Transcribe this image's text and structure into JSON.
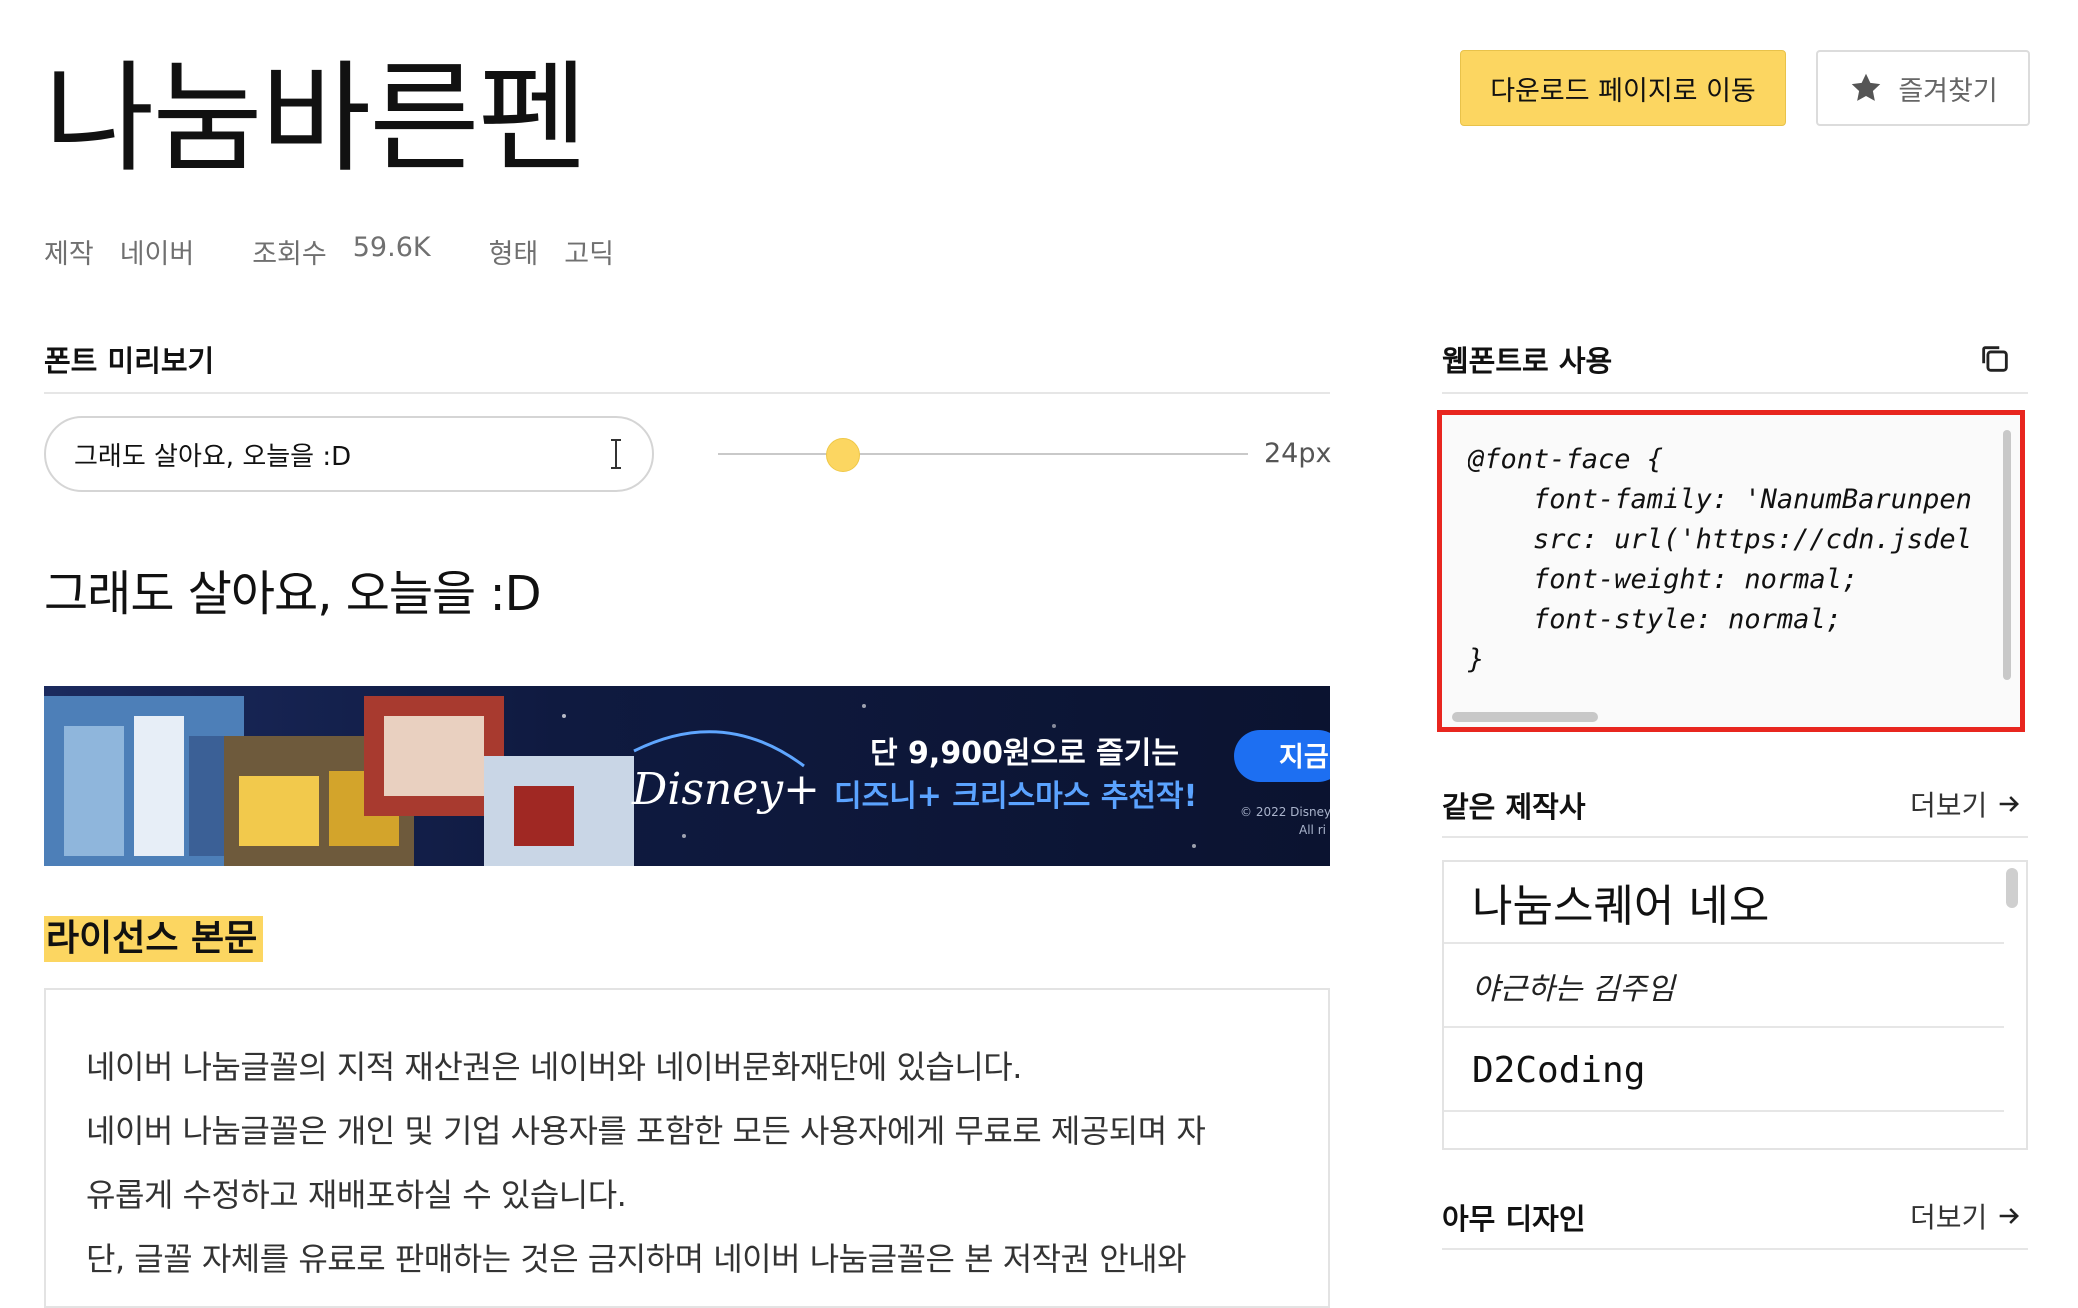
{
  "header": {
    "font_name": "나눔바른펜",
    "meta": [
      {
        "label": "제작",
        "value": "네이버"
      },
      {
        "label": "조회수",
        "value": "59.6K"
      },
      {
        "label": "형태",
        "value": "고딕"
      }
    ],
    "download_label": "다운로드 페이지로 이동",
    "favorite_label": "즐겨찾기"
  },
  "preview": {
    "section_title": "폰트 미리보기",
    "input_value": "그래도 살아요, 오늘을 :D",
    "size_value": 24,
    "size_label": "24px",
    "preview_text": "그래도 살아요, 오늘을 :D"
  },
  "banner": {
    "headline": "단 9,900원으로 즐기는",
    "subline": "디즈니+ 크리스마스 추천작!",
    "cta": "지금",
    "brand": "Disney+",
    "copyright": "© 2022 Disney",
    "copyright_2": "All ri"
  },
  "license": {
    "title": "라이선스 본문",
    "lines": [
      "네이버 나눔글꼴의 지적 재산권은 네이버와 네이버문화재단에 있습니다.",
      "네이버 나눔글꼴은 개인 및 기업 사용자를 포함한 모든 사용자에게 무료로 제공되며 자",
      "유롭게 수정하고 재배포하실 수 있습니다.",
      "단, 글꼴 자체를 유료로 판매하는 것은 금지하며 네이버 나눔글꼴은 본 저작권 안내와"
    ]
  },
  "webfont": {
    "title": "웹폰트로 사용",
    "code": "@font-face {\n    font-family: 'NanumBarunpen\n    src: url('https://cdn.jsdel\n    font-weight: normal;\n    font-style: normal;\n}"
  },
  "same_maker": {
    "title": "같은 제작사",
    "more_label": "더보기",
    "items": [
      "나눔스퀘어 네오",
      "야근하는 김주임",
      "D2Coding"
    ]
  },
  "amu": {
    "title": "아무 디자인",
    "more_label": "더보기"
  },
  "colors": {
    "accent": "#fcd661",
    "highlight_border": "#e8261f"
  }
}
